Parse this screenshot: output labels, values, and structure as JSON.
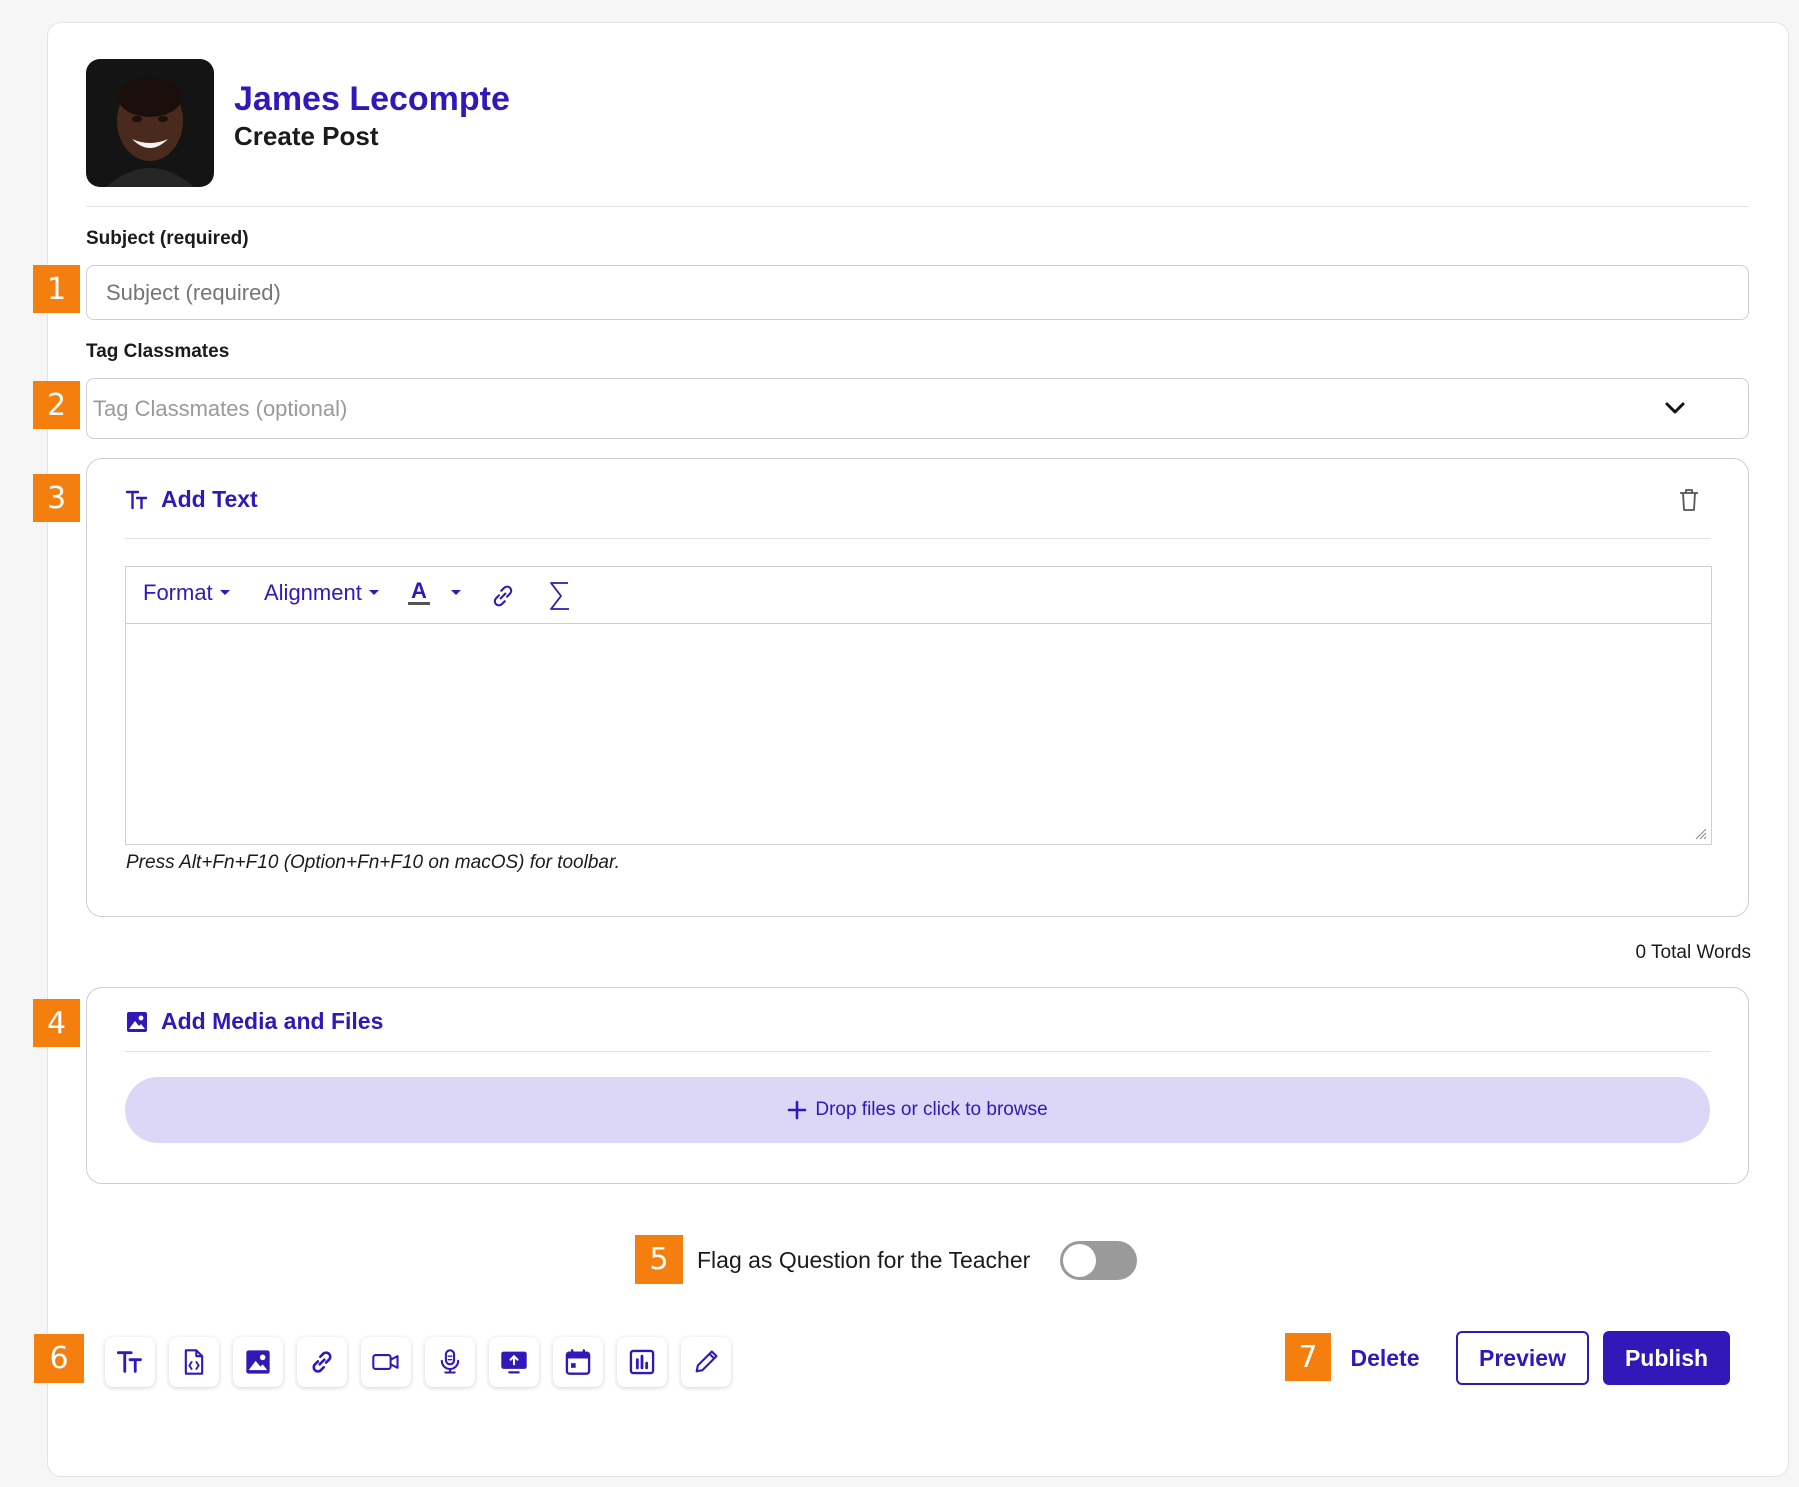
{
  "header": {
    "user_name": "James Lecompte",
    "page_subtitle": "Create Post"
  },
  "form": {
    "subject_label": "Subject (required)",
    "subject_placeholder": "Subject (required)",
    "subject_value": "",
    "tag_label": "Tag Classmates",
    "tag_placeholder": "Tag Classmates (optional)"
  },
  "text_panel": {
    "title": "Add Text",
    "toolbar": {
      "format_label": "Format",
      "alignment_label": "Alignment",
      "text_color_label": "A"
    },
    "hint": "Press Alt+Fn+F10 (Option+Fn+F10 on macOS) for toolbar.",
    "word_count": "0 Total Words"
  },
  "media_panel": {
    "title": "Add Media and Files",
    "drop_label": "Drop files or click to browse"
  },
  "flag": {
    "label": "Flag as Question for the Teacher",
    "enabled": false
  },
  "insert_tools": [
    "text-icon",
    "code-file-icon",
    "image-icon",
    "link-icon",
    "video-icon",
    "microphone-icon",
    "screen-upload-icon",
    "calendar-icon",
    "chart-icon",
    "pencil-icon"
  ],
  "actions": {
    "delete_label": "Delete",
    "preview_label": "Preview",
    "publish_label": "Publish"
  },
  "markers": [
    "1",
    "2",
    "3",
    "4",
    "5",
    "6",
    "7"
  ],
  "colors": {
    "accent": "#3318b9",
    "marker": "#f57f0e",
    "dropzone": "#dcd6f7",
    "toggle_off": "#9a9a9a"
  }
}
